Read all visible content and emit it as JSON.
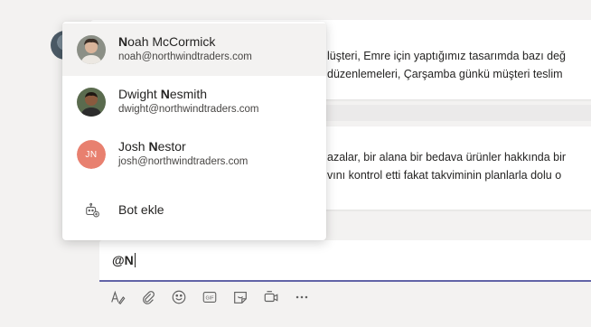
{
  "chat": {
    "message1_line1": "lüşteri, Emre için yaptığımız tasarımda bazı değ",
    "message1_line2": "düzenlemeleri, Çarşamba günkü müşteri teslim",
    "message2_line1": "azalar, bir alana bir bedava ürünler hakkında bir",
    "message2_line2": "vını kontrol etti fakat takviminin planlarla dolu o"
  },
  "mention_popup": {
    "items": [
      {
        "name_bold": "N",
        "name_rest": "oah McCormick",
        "email": "noah@northwindtraders.com",
        "selected": true
      },
      {
        "name_pre": "Dwight ",
        "name_bold": "N",
        "name_rest": "esmith",
        "email": "dwight@northwindtraders.com"
      },
      {
        "name_pre": "Josh ",
        "name_bold": "N",
        "name_rest": "estor",
        "email": "josh@northwindtraders.com",
        "initials": "JN"
      }
    ],
    "bot_label": "Bot ekle"
  },
  "compose": {
    "text": "@N"
  },
  "toolbar": {
    "icons": [
      "format-icon",
      "attach-icon",
      "emoji-icon",
      "gif-icon",
      "sticker-icon",
      "meet-now-icon",
      "more-options-icon"
    ],
    "gif_label": "GIF"
  },
  "colors": {
    "accent": "#6264a7",
    "initials_bg": "#e8806f"
  }
}
